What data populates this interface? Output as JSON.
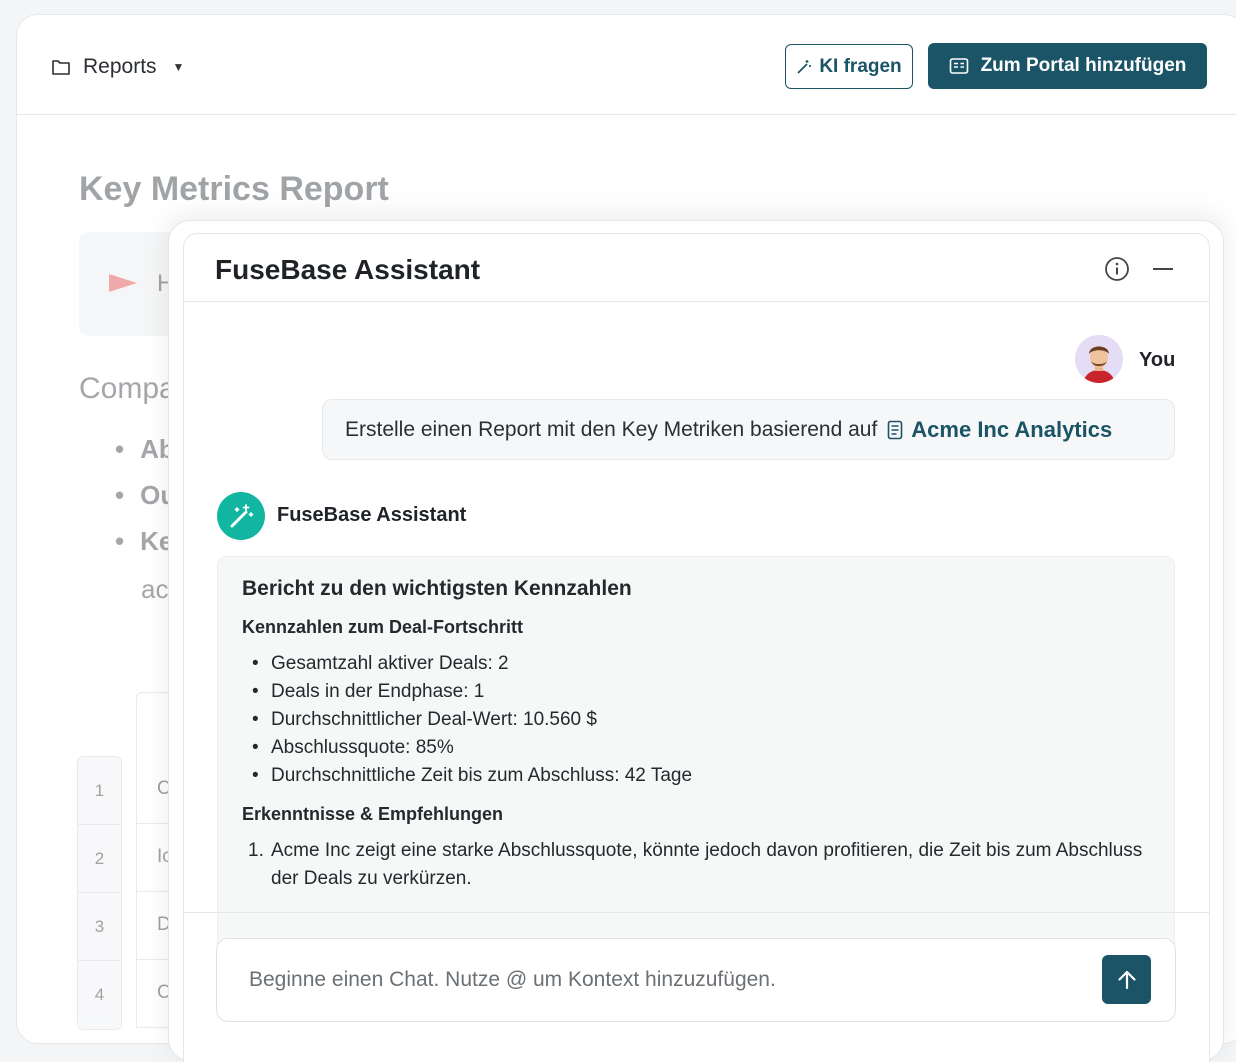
{
  "topbar": {
    "breadcrumb_label": "Reports",
    "ai_button_label": "KI fragen",
    "portal_button_label": "Zum Portal hinzufügen"
  },
  "document": {
    "title": "Key Metrics Report",
    "callout_fragment": "H",
    "section_fragment": "Compa",
    "bullets": [
      "Ab",
      "Ou",
      "Ke"
    ],
    "bullet_continuation": "ac",
    "table_row_numbers": [
      "1",
      "2",
      "3",
      "4"
    ],
    "table_cells": [
      "C",
      "Ic",
      "D",
      "C"
    ]
  },
  "assistant_panel": {
    "title": "FuseBase Assistant",
    "user": {
      "name": "You",
      "message": "Erstelle einen Report mit den Key Metriken basierend auf",
      "reference": "Acme Inc Analytics"
    },
    "assistant_name": "FuseBase Assistant",
    "reply": {
      "heading": "Bericht zu den wichtigsten Kennzahlen",
      "section1_heading": "Kennzahlen zum Deal-Fortschritt",
      "section1_items": [
        "Gesamtzahl aktiver Deals: 2",
        "Deals in der Endphase: 1",
        "Durchschnittlicher Deal-Wert: 10.560 $",
        "Abschlussquote: 85%",
        "Durchschnittliche Zeit bis zum Abschluss: 42 Tage"
      ],
      "section2_heading": "Erkenntnisse & Empfehlungen",
      "section2_items": [
        "Acme Inc zeigt eine starke Abschlussquote, könnte jedoch davon profitieren, die Zeit bis zum Abschluss der Deals zu verkürzen."
      ]
    },
    "composer_placeholder": "Beginne einen Chat. Nutze @ um Kontext hinzuzufügen."
  },
  "colors": {
    "primary": "#1b5466",
    "assistant_avatar": "#12b5a0"
  },
  "icons": [
    "folder-icon",
    "chevron-down-icon",
    "magic-wand-icon",
    "portal-icon",
    "flag-icon",
    "info-icon",
    "minimize-icon",
    "document-icon",
    "arrow-up-icon"
  ]
}
